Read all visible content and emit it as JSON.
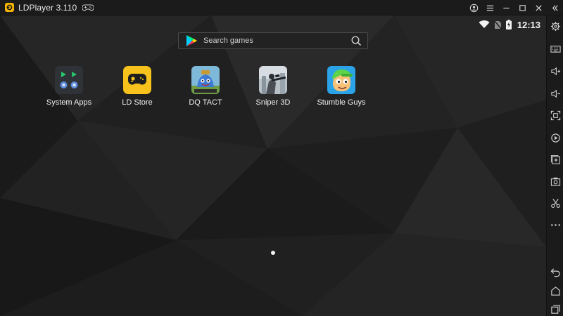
{
  "window": {
    "title": "LDPlayer 3.110",
    "controls": [
      "account-icon",
      "menu-icon",
      "minimize-icon",
      "maximize-icon",
      "close-icon",
      "collapse-sidebar-icon"
    ]
  },
  "statusbar": {
    "time": "12:13",
    "icons": [
      "wifi-icon",
      "no-sim-icon",
      "battery-charging-icon"
    ]
  },
  "search": {
    "placeholder": "Search games"
  },
  "apps": [
    {
      "label": "System Apps",
      "icon": "system-apps-icon"
    },
    {
      "label": "LD Store",
      "icon": "ld-store-icon",
      "color": "#f6c21b"
    },
    {
      "label": "DQ TACT",
      "icon": "dq-tact-icon"
    },
    {
      "label": "Sniper 3D",
      "icon": "sniper-3d-icon"
    },
    {
      "label": "Stumble Guys",
      "icon": "stumble-guys-icon"
    }
  ],
  "toolbar": {
    "items": [
      "settings-icon",
      "keyboard-icon",
      "volume-up-icon",
      "volume-down-icon",
      "fullscreen-icon",
      "record-icon",
      "add-apk-icon",
      "screenshot-icon",
      "scissors-icon",
      "more-icon",
      "back-icon",
      "home-icon",
      "recents-icon"
    ]
  },
  "colors": {
    "titlebar": "#1b1b1b",
    "wallpaper": "#1a1a1a",
    "accent": "#f4b400"
  }
}
